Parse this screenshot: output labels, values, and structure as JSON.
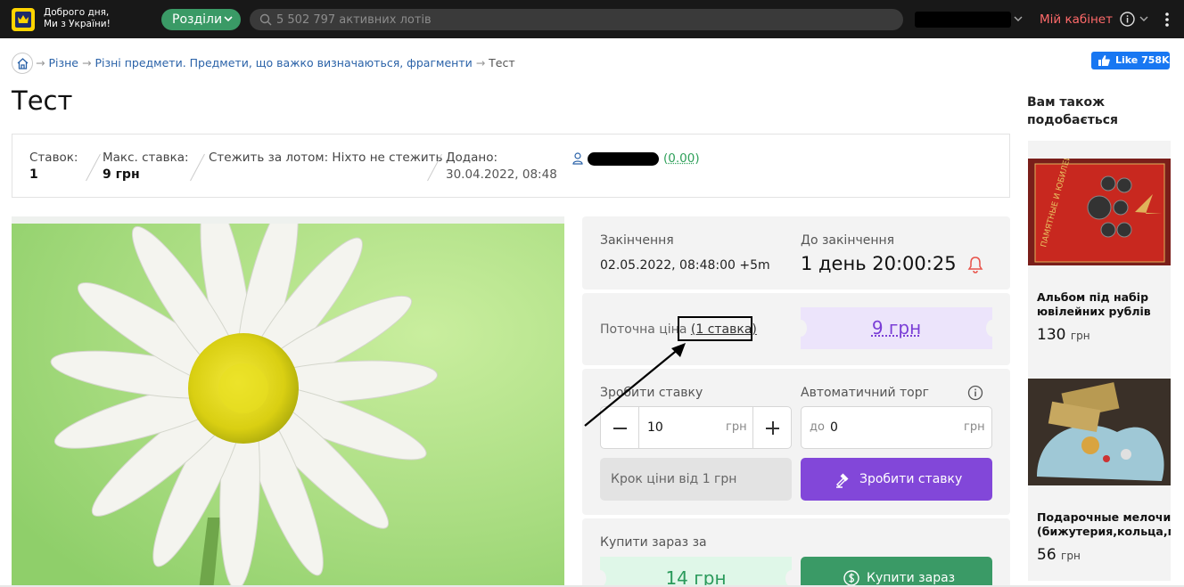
{
  "topbar": {
    "greeting_line1": "Доброго дня,",
    "greeting_line2": "Ми з України!",
    "sections_label": "Розділи",
    "search_placeholder": "5 502 797 активних лотів",
    "cabinet_label": "Мій кабінет",
    "icons": [
      "logo-crown-icon",
      "chevron-down-icon",
      "search-icon",
      "info-icon",
      "kebab-menu-icon"
    ],
    "colors": {
      "bar": "#181818",
      "accent_green": "#3a9a66",
      "cabinet_red": "#ff6a6a"
    }
  },
  "breadcrumb": {
    "items": [
      "Різне",
      "Різні предмети. Предмети, що важко визначаються, фрагменти"
    ],
    "current": "Тест",
    "separator": "→"
  },
  "fb": {
    "like_label": "Like 758K"
  },
  "title": "Тест",
  "info": {
    "bids_label": "Ставок:",
    "bids_value": "1",
    "max_bid_label": "Макс. ставка:",
    "max_bid_value": "9 грн",
    "watch_text": "Стежить за лотом: Ніхто не стежить",
    "added_label": "Додано:",
    "added_value": "30.04.2022, 08:48",
    "seller_score": "0.00"
  },
  "auction": {
    "end_label": "Закінчення",
    "end_value": "02.05.2022, 08:48:00 +5m",
    "countdown_label": "До закінчення",
    "countdown_value": "1 день 20:00:25",
    "current_price_label": "Поточна ціна",
    "bids_link": "(1 ставка)",
    "current_price": "9 грн",
    "make_bid_label": "Зробити ставку",
    "bid_value": "10",
    "currency": "грн",
    "auto_label": "Автоматичний торг",
    "auto_prefix": "до",
    "auto_value": "0",
    "step_hint": "Крок ціни від 1 грн",
    "bid_button": "Зробити ставку",
    "buy_now_label": "Купити зараз за",
    "buy_now_price": "14 грн",
    "buy_button": "Купити зараз",
    "colors": {
      "purple": "#8247d9",
      "green": "#3a9a66"
    }
  },
  "sidebar": {
    "title": "Вам також подобається",
    "items": [
      {
        "name": "Альбом під набір ювілейних рублів",
        "price": "130",
        "currency": "грн"
      },
      {
        "name": "Подарочные мелочи (бижутерия,кольца,подв",
        "price": "56",
        "currency": "грн"
      }
    ]
  }
}
